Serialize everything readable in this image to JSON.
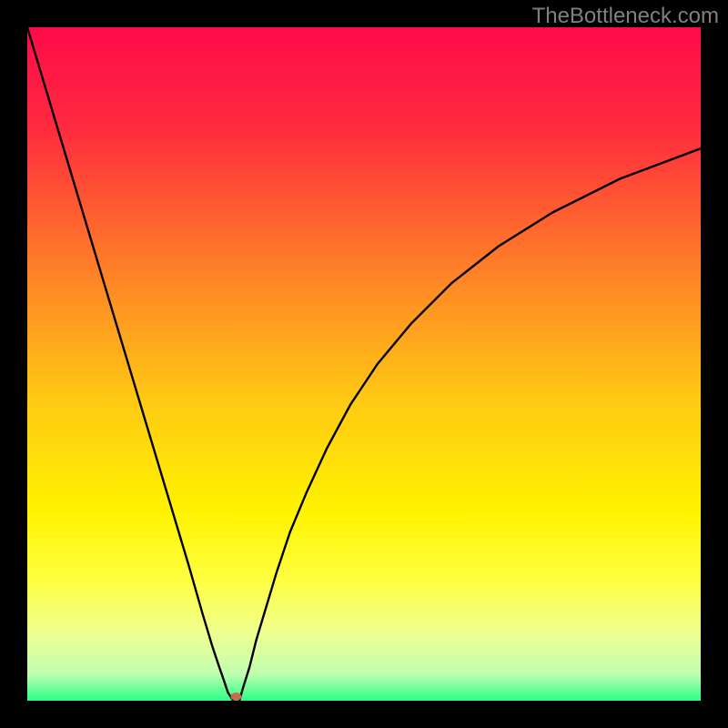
{
  "watermark": "TheBottleneck.com",
  "chart_data": {
    "type": "line",
    "title": "",
    "xlabel": "",
    "ylabel": "",
    "xlim": [
      0,
      100
    ],
    "ylim": [
      0,
      100
    ],
    "background_gradient": {
      "stops": [
        {
          "offset": 0.0,
          "color": "#ff0a4a"
        },
        {
          "offset": 0.15,
          "color": "#ff2b3e"
        },
        {
          "offset": 0.35,
          "color": "#ff7c29"
        },
        {
          "offset": 0.55,
          "color": "#ffc814"
        },
        {
          "offset": 0.72,
          "color": "#fff300"
        },
        {
          "offset": 0.82,
          "color": "#feff40"
        },
        {
          "offset": 0.9,
          "color": "#f0ff90"
        },
        {
          "offset": 0.96,
          "color": "#c0ffb0"
        },
        {
          "offset": 1.0,
          "color": "#2bff88"
        }
      ]
    },
    "series": [
      {
        "name": "left-branch",
        "x": [
          0,
          3,
          6,
          9,
          12,
          15,
          18,
          21,
          24,
          26,
          27.5,
          28.5,
          29.2,
          29.8,
          30.6
        ],
        "y": [
          100,
          90,
          80,
          70,
          60,
          50,
          40,
          30,
          20,
          13,
          8,
          5,
          3,
          1.2,
          0
        ]
      },
      {
        "name": "right-branch",
        "x": [
          31.5,
          32,
          33,
          34,
          35.5,
          37,
          39,
          41.5,
          44.5,
          48,
          52,
          57,
          63,
          70,
          78,
          88,
          100
        ],
        "y": [
          0,
          1.8,
          5,
          9,
          14,
          19,
          25,
          31,
          37.5,
          44,
          50,
          56,
          62,
          67.5,
          72.5,
          77.5,
          82
        ]
      }
    ],
    "marker": {
      "name": "min-point",
      "x": 31,
      "y": 0,
      "rx": 6,
      "ry": 4.5,
      "color": "#c86a50"
    }
  }
}
